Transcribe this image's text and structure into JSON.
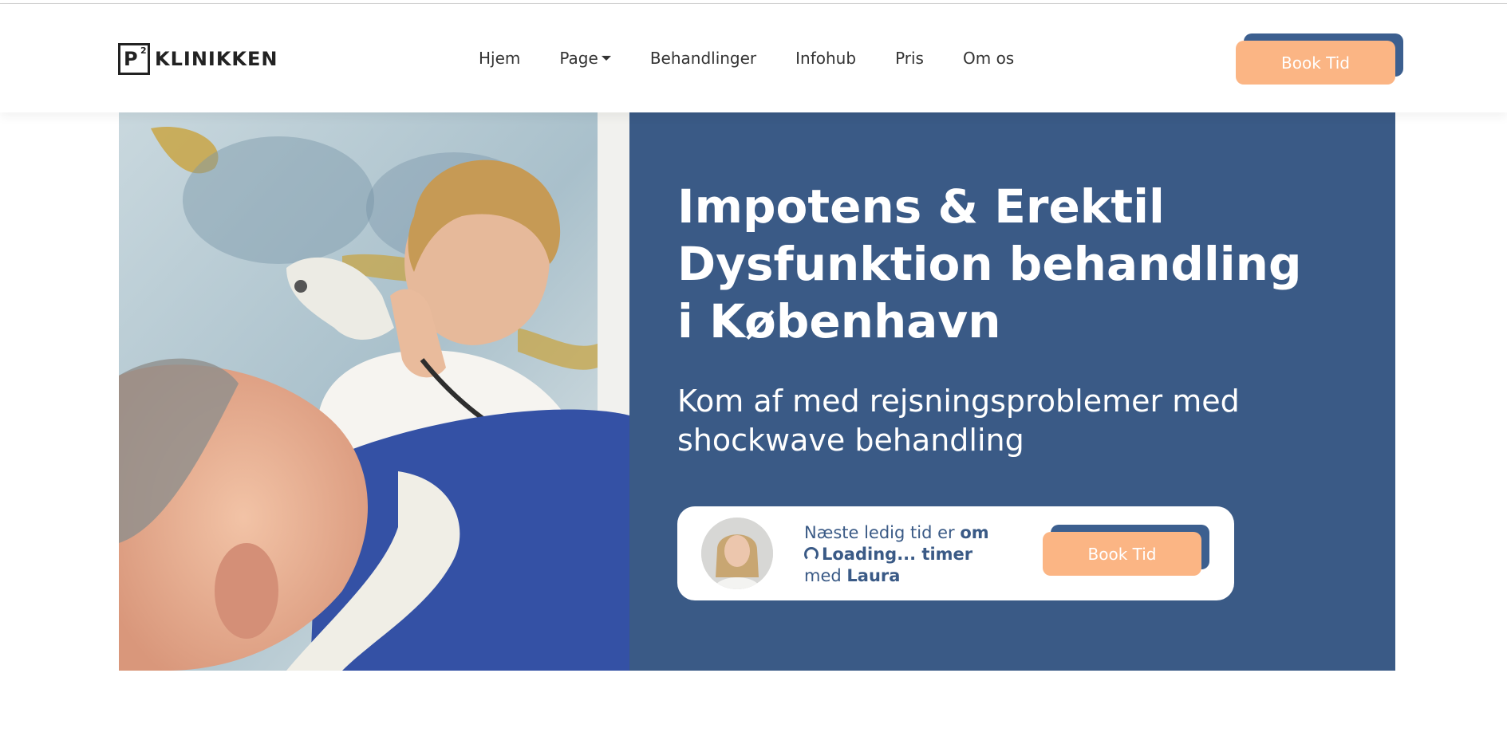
{
  "header": {
    "logo": {
      "mark": "P",
      "superscript": "2",
      "text": "KLINIKKEN"
    },
    "nav": [
      {
        "label": "Hjem"
      },
      {
        "label": "Page",
        "has_dropdown": true
      },
      {
        "label": "Behandlinger"
      },
      {
        "label": "Infohub"
      },
      {
        "label": "Pris"
      },
      {
        "label": "Om os"
      }
    ],
    "book_label": "Book Tid"
  },
  "hero": {
    "title": "Impotens & Erektil Dysfunktion behandling i København",
    "subtitle": "Kom af med rejsningsproblemer med shockwave behandling",
    "image_description": "photo-treatment-shockwave",
    "availability": {
      "prefix": "Næste ledig tid er",
      "om": "om",
      "loading": "Loading... timer",
      "med": "med",
      "name": "Laura",
      "book_label": "Book Tid"
    }
  },
  "colors": {
    "panel": "#3a5a86",
    "accent": "#fbb584",
    "button_shadow": "#3c5f8f"
  }
}
